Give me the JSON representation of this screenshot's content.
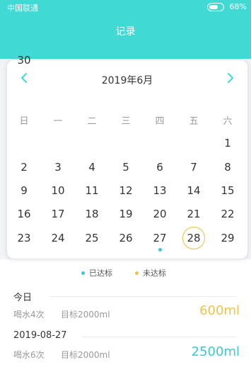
{
  "status": {
    "carrier": "中国联通",
    "battery": "68%",
    "battery_level": 0.68
  },
  "header": {
    "title": "记录"
  },
  "calendar": {
    "month_title": "2019年6月",
    "weekdays": [
      "日",
      "一",
      "二",
      "三",
      "四",
      "五",
      "六"
    ],
    "days": [
      "1",
      "2",
      "3",
      "4",
      "5",
      "6",
      "7",
      "8",
      "9",
      "10",
      "11",
      "12",
      "13",
      "14",
      "15",
      "16",
      "17",
      "18",
      "19",
      "20",
      "21",
      "22",
      "23",
      "24",
      "25",
      "26",
      "27",
      "28",
      "29",
      "30"
    ],
    "today": "28",
    "achieved_days": [
      "27"
    ]
  },
  "legend": {
    "achieved": "已达标",
    "not_achieved": "未达标"
  },
  "colors": {
    "accent": "#40d9d3",
    "achieved": "#3cc9cf",
    "not_achieved": "#efc34b",
    "today_ring": "#e8c23d"
  },
  "records": [
    {
      "title": "今日",
      "count": "喝水4次",
      "target": "目标2000ml",
      "amount": "600ml",
      "status": "not_achieved"
    },
    {
      "title": "2019-08-27",
      "count": "喝水6次",
      "target": "目标2000ml",
      "amount": "2500ml",
      "status": "achieved"
    }
  ]
}
